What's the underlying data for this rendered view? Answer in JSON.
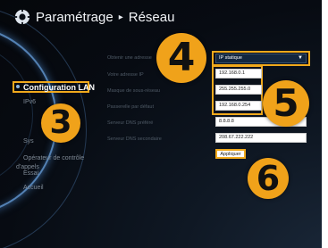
{
  "header": {
    "title": "Paramétrage",
    "separator": "▸",
    "section": "Réseau"
  },
  "menu": {
    "active": "Configuration LAN",
    "items": [
      "IPv6",
      "Sys",
      "Opérateur de contrôle",
      "d'appels",
      "Essai",
      "Accueil"
    ]
  },
  "form": {
    "labels": [
      "Obtenir une adresse",
      "Votre adresse IP",
      "Masque de sous-réseau",
      "Passerelle par défaut",
      "Serveur DNS préféré",
      "Serveur DNS secondaire"
    ],
    "select_value": "IP statique",
    "ip": "192.168.0.1",
    "mask": "255.255.255.0",
    "gateway": "192.168.0.254",
    "dns1": "8.8.8.8",
    "dns2": "208.67.222.222",
    "apply": "Appliquer"
  },
  "badges": [
    "3",
    "4",
    "5",
    "6"
  ],
  "colors": {
    "accent": "#f0a91c",
    "background": "#070b12",
    "select_bg": "#12263f"
  }
}
